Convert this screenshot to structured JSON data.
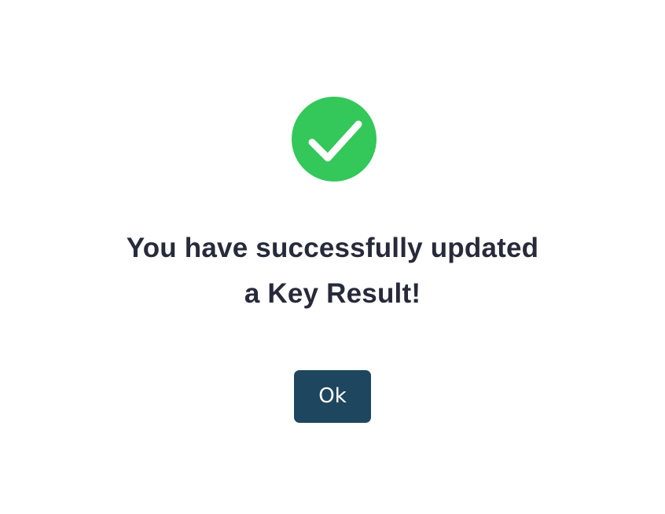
{
  "dialog": {
    "icon": "checkmark-circle-icon",
    "message_line1": "You have successfully updated",
    "message_line2": "a Key Result!",
    "ok_label": "Ok"
  },
  "colors": {
    "success": "#34c759",
    "text": "#272a3a",
    "button": "#1e465f",
    "button_text": "#ffffff",
    "background": "#ffffff"
  }
}
